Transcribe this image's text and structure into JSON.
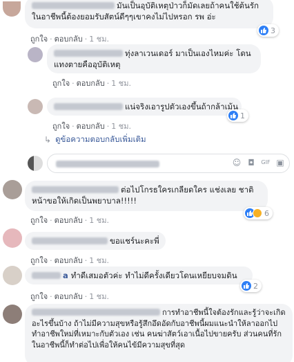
{
  "comments": [
    {
      "id": "c1",
      "name": "",
      "text": "มันเป็นอุบัติเหตุป่าวก็มัดเลยถ้าคนใช้ต้นรักในอาชีพนี้ต้องยอมรับสัตน์ดีๆๆเขาคงไม่ไปหรอก รพ อ่ะ",
      "reaction_count": "3",
      "like_label": "ถูกใจ",
      "reply_label": "ตอบกลับ",
      "time": "1 ชม."
    },
    {
      "id": "c2",
      "name": "",
      "text": "ทุ่งลาเวนเดอร์ มาเป็นเองไหมค่ะ โดนแทงตายคืออุบัติเหตุ",
      "like_label": "ถูกใจ",
      "reply_label": "ตอบกลับ",
      "time": "1 ชม."
    },
    {
      "id": "c3",
      "name": "",
      "text": "แน่จริงเอารูปตัวเองขึ้นถ้ากล้าเม้น",
      "reaction_count": "1",
      "like_label": "ถูกใจ",
      "reply_label": "ตอบกลับ",
      "time": "1 ชม."
    },
    {
      "id": "c4",
      "name": "",
      "text": "ต่อไปโกรธใครเกลียดใคร แช่งเลย ชาติหน้าขอให้เกิดเป็นพยาบาล!!!!!",
      "reaction_count": "6",
      "like_label": "ถูกใจ",
      "reply_label": "ตอบกลับ",
      "time": "1 ชม."
    },
    {
      "id": "c5",
      "name": "",
      "text": "ขอแชร์นะคะพี่",
      "like_label": "ถูกใจ",
      "reply_label": "ตอบกลับ",
      "time": "1 ชม."
    },
    {
      "id": "c6",
      "name": "a",
      "text": "ทำดีเสมอตัวค่ะ ทำไม่ดีครั้งเดียวโดนเหยียบจมดิน",
      "reaction_count": "2",
      "like_label": "ถูกใจ",
      "reply_label": "ตอบกลับ",
      "time": "1 ชม."
    },
    {
      "id": "c7",
      "name": "",
      "text": "การทำอาชีพนี้ใจต้องรักและรู้ว่าจะเกิดอะไรขึ้นบ้าง ถ้าไม่มีความสุขหรือรู้สึกอึดอัดกับอาชีพนี้ผมแนะนำให้ลาออกไปทำอาชีพใหม่ที่เหมาะกับตัวเอง เช่น คนฆ่าสัตว์เอาเนื้อไปขายครับ ส่วนคนที่รักในอาชีพนี้ก็ทำต่อไปเพื่อให้คนไข้มีความสุขที่สุด"
    }
  ],
  "more_replies": {
    "label": "ดูข้อความตอบกลับเพิ่มเติม"
  },
  "colors": {
    "link": "#385898",
    "bubble": "#f2f3f5",
    "like_blue": "#2e7ff6",
    "haha_yellow": "#f7b125"
  },
  "icons": [
    "reply-arrow-icon",
    "like-reaction-icon",
    "haha-reaction-icon",
    "emoji-icon",
    "camera-icon",
    "gif-icon",
    "sticker-icon"
  ]
}
